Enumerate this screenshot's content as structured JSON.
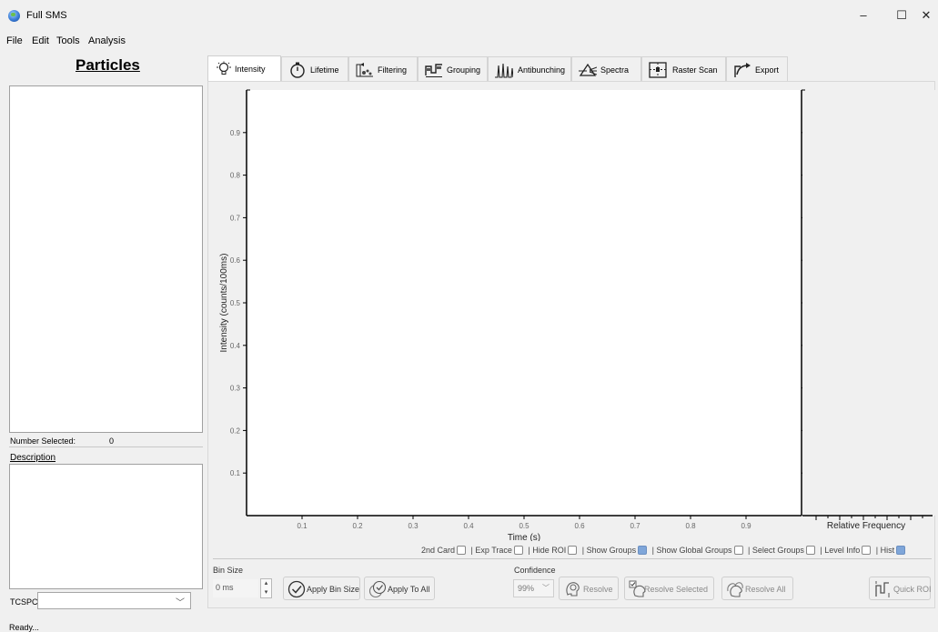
{
  "window": {
    "title": "Full SMS",
    "minimize": "–",
    "maximize": "☐",
    "close": "✕"
  },
  "menu": [
    "File",
    "Edit",
    "Tools",
    "Analysis"
  ],
  "left_panel": {
    "heading": "Particles",
    "number_selected_label": "Number Selected:",
    "number_selected_value": "0",
    "description_label": "Description",
    "tcspc_label": "TCSPC Card:",
    "tcspc_value": ""
  },
  "tabs": [
    {
      "label": "Intensity",
      "icon": "bulb-icon",
      "active": true
    },
    {
      "label": "Lifetime",
      "icon": "stopwatch-icon",
      "active": false
    },
    {
      "label": "Filtering",
      "icon": "filter-icon",
      "active": false
    },
    {
      "label": "Grouping",
      "icon": "grouping-icon",
      "active": false
    },
    {
      "label": "Antibunching",
      "icon": "peaks-icon",
      "active": false
    },
    {
      "label": "Spectra",
      "icon": "prism-icon",
      "active": false
    },
    {
      "label": "Raster Scan",
      "icon": "raster-icon",
      "active": false
    },
    {
      "label": "Export",
      "icon": "export-icon",
      "active": false
    }
  ],
  "chart_data": {
    "type": "line",
    "series": [],
    "xlabel": "Time (s)",
    "ylabel": "Intensity (counts/100ms)",
    "x_ticks": [
      "0.1",
      "0.2",
      "0.3",
      "0.4",
      "0.5",
      "0.6",
      "0.7",
      "0.8",
      "0.9"
    ],
    "y_ticks": [
      "0.1",
      "0.2",
      "0.3",
      "0.4",
      "0.5",
      "0.6",
      "0.7",
      "0.8",
      "0.9"
    ],
    "xlim": [
      0,
      1
    ],
    "ylim": [
      0,
      1
    ],
    "hist_xlabel": "Relative Frequency"
  },
  "options": [
    {
      "label": "2nd Card",
      "checked": false
    },
    {
      "label": "Exp Trace",
      "checked": false
    },
    {
      "label": "Hide ROI",
      "checked": false
    },
    {
      "label": "Show Groups",
      "checked": true
    },
    {
      "label": "Show Global Groups",
      "checked": false
    },
    {
      "label": "Select Groups",
      "checked": false
    },
    {
      "label": "Level Info",
      "checked": false
    },
    {
      "label": "Hist",
      "checked": true
    }
  ],
  "controls": {
    "bin_size_label": "Bin Size",
    "bin_size_value": "0 ms",
    "apply_bin_size": "Apply Bin Size",
    "apply_to_all": "Apply To All",
    "confidence_label": "Confidence",
    "confidence_value": "99%",
    "resolve": "Resolve",
    "resolve_selected": "Resolve Selected",
    "resolve_all": "Resolve All",
    "quick_roi": "Quick ROI"
  },
  "status": "Ready..."
}
